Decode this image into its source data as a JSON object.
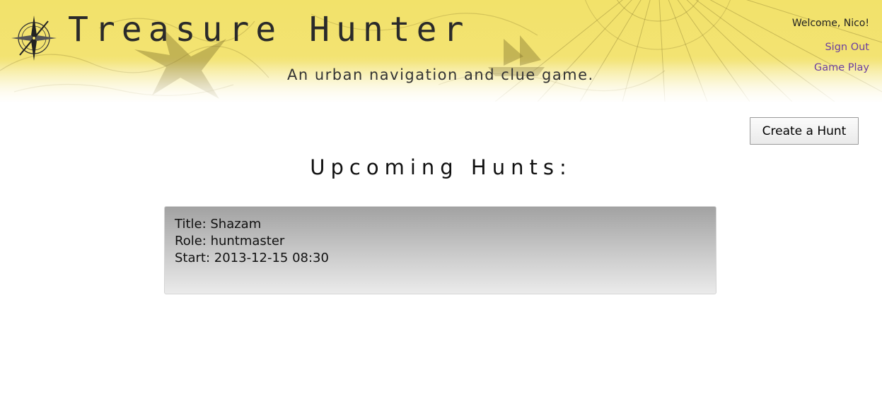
{
  "header": {
    "title": "Treasure Hunter",
    "tagline": "An urban navigation and clue game.",
    "welcome": "Welcome, Nico!",
    "links": {
      "sign_out": "Sign Out",
      "game_play": "Game Play"
    },
    "icons": {
      "logo": "compass-rose-icon"
    },
    "colors": {
      "banner": "#f2e26a",
      "link": "#6b3fa0"
    }
  },
  "toolbar": {
    "create_label": "Create a Hunt"
  },
  "main": {
    "section_title": "Upcoming Hunts:",
    "hunts": [
      {
        "title_line": "Title: Shazam",
        "role_line": "Role: huntmaster",
        "start_line": "Start: 2013-12-15 08:30"
      }
    ]
  }
}
